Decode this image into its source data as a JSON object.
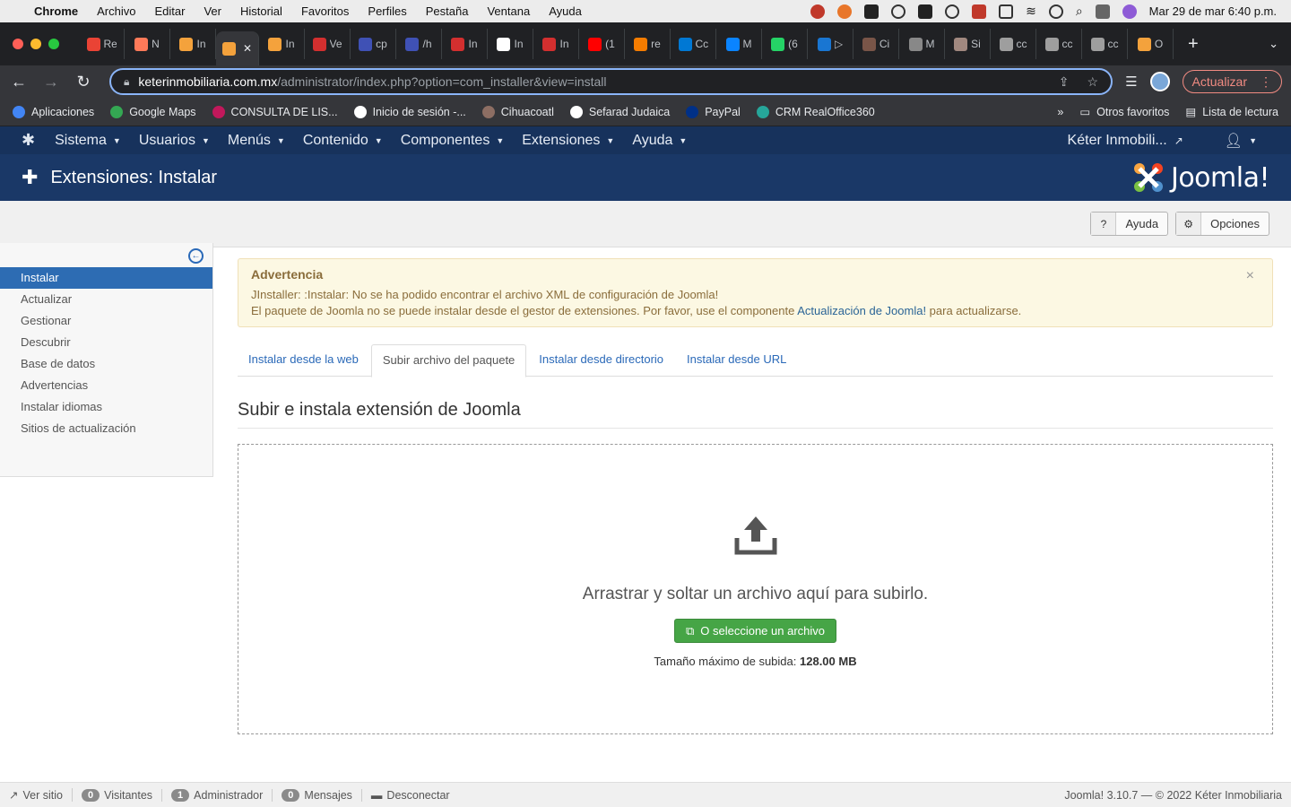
{
  "mac_menubar": {
    "app": "Chrome",
    "items": [
      "Archivo",
      "Editar",
      "Ver",
      "Historial",
      "Favoritos",
      "Perfiles",
      "Pestaña",
      "Ventana",
      "Ayuda"
    ],
    "clock": "Mar 29 de mar  6:40 p.m."
  },
  "browser": {
    "tabs": [
      {
        "label": "Re",
        "color": "#ea4335"
      },
      {
        "label": "N",
        "color": "#ff7a59"
      },
      {
        "label": "In",
        "color": "#f4a23c"
      },
      {
        "label": "",
        "color": "#f4a23c",
        "active": true
      },
      {
        "label": "In",
        "color": "#f4a23c"
      },
      {
        "label": "Ve",
        "color": "#d32f2f"
      },
      {
        "label": "cp",
        "color": "#3f51b5"
      },
      {
        "label": "/h",
        "color": "#3f51b5"
      },
      {
        "label": "In",
        "color": "#d32f2f"
      },
      {
        "label": "In",
        "color": "#ffffff"
      },
      {
        "label": "In",
        "color": "#d32f2f"
      },
      {
        "label": "(1",
        "color": "#ff0000"
      },
      {
        "label": "re",
        "color": "#f57c00"
      },
      {
        "label": "Cc",
        "color": "#0078d4"
      },
      {
        "label": "M",
        "color": "#0a84ff"
      },
      {
        "label": "(6",
        "color": "#25d366"
      },
      {
        "label": "▷",
        "color": "#1976d2"
      },
      {
        "label": "Ci",
        "color": "#795548"
      },
      {
        "label": "M",
        "color": "#888888"
      },
      {
        "label": "Si",
        "color": "#a1887f"
      },
      {
        "label": "cc",
        "color": "#9e9e9e"
      },
      {
        "label": "cc",
        "color": "#9e9e9e"
      },
      {
        "label": "cc",
        "color": "#9e9e9e"
      },
      {
        "label": "O",
        "color": "#f4a23c"
      }
    ],
    "url_host": "keterinmobiliaria.com.mx",
    "url_path": "/administrator/index.php?option=com_installer&view=install",
    "update_label": "Actualizar",
    "bookmarks": [
      {
        "label": "Aplicaciones",
        "color": "#4285f4"
      },
      {
        "label": "Google Maps",
        "color": "#34a853"
      },
      {
        "label": "CONSULTA DE LIS...",
        "color": "#c2185b"
      },
      {
        "label": "Inicio de sesión -...",
        "color": "#ffffff"
      },
      {
        "label": "Cihuacoatl",
        "color": "#8d6e63"
      },
      {
        "label": "Sefarad Judaica",
        "color": "#ffffff"
      },
      {
        "label": "PayPal",
        "color": "#003087"
      },
      {
        "label": "CRM RealOffice360",
        "color": "#26a69a"
      }
    ],
    "bookmarks_overflow": "»",
    "other_bookmarks": "Otros favoritos",
    "reading_list": "Lista de lectura"
  },
  "joomla_nav": {
    "items": [
      "Sistema",
      "Usuarios",
      "Menús",
      "Contenido",
      "Componentes",
      "Extensiones",
      "Ayuda"
    ],
    "site_name": "Kéter Inmobili..."
  },
  "header": {
    "title": "Extensiones: Instalar",
    "logo_text": "Joomla!"
  },
  "toolbar": {
    "help_label": "Ayuda",
    "options_label": "Opciones"
  },
  "sidebar": {
    "items": [
      {
        "label": "Instalar",
        "active": true
      },
      {
        "label": "Actualizar"
      },
      {
        "label": "Gestionar"
      },
      {
        "label": "Descubrir"
      },
      {
        "label": "Base de datos"
      },
      {
        "label": "Advertencias"
      },
      {
        "label": "Instalar idiomas"
      },
      {
        "label": "Sitios de actualización"
      }
    ]
  },
  "alert": {
    "heading": "Advertencia",
    "line1": "JInstaller: :Instalar: No se ha podido encontrar el archivo XML de configuración de Joomla!",
    "line2_pre": "El paquete de Joomla no se puede instalar desde el gestor de extensiones. Por favor, use el componente ",
    "line2_link": "Actualización de Joomla!",
    "line2_post": " para actualizarse."
  },
  "install_tabs": [
    {
      "label": "Instalar desde la web"
    },
    {
      "label": "Subir archivo del paquete",
      "active": true
    },
    {
      "label": "Instalar desde directorio"
    },
    {
      "label": "Instalar desde URL"
    }
  ],
  "upload": {
    "section_title": "Subir e instala extensión de Joomla",
    "drop_text": "Arrastrar y soltar un archivo aquí para subirlo.",
    "select_button": "O seleccione un archivo",
    "max_size_label": "Tamaño máximo de subida:",
    "max_size_value": "128.00 MB"
  },
  "statusbar": {
    "view_site": "Ver sitio",
    "visitors_count": "0",
    "visitors_label": "Visitantes",
    "admins_count": "1",
    "admins_label": "Administrador",
    "messages_count": "0",
    "messages_label": "Mensajes",
    "logout": "Desconectar",
    "version": "Joomla! 3.10.7  —  © 2022 Kéter Inmobiliaria"
  }
}
